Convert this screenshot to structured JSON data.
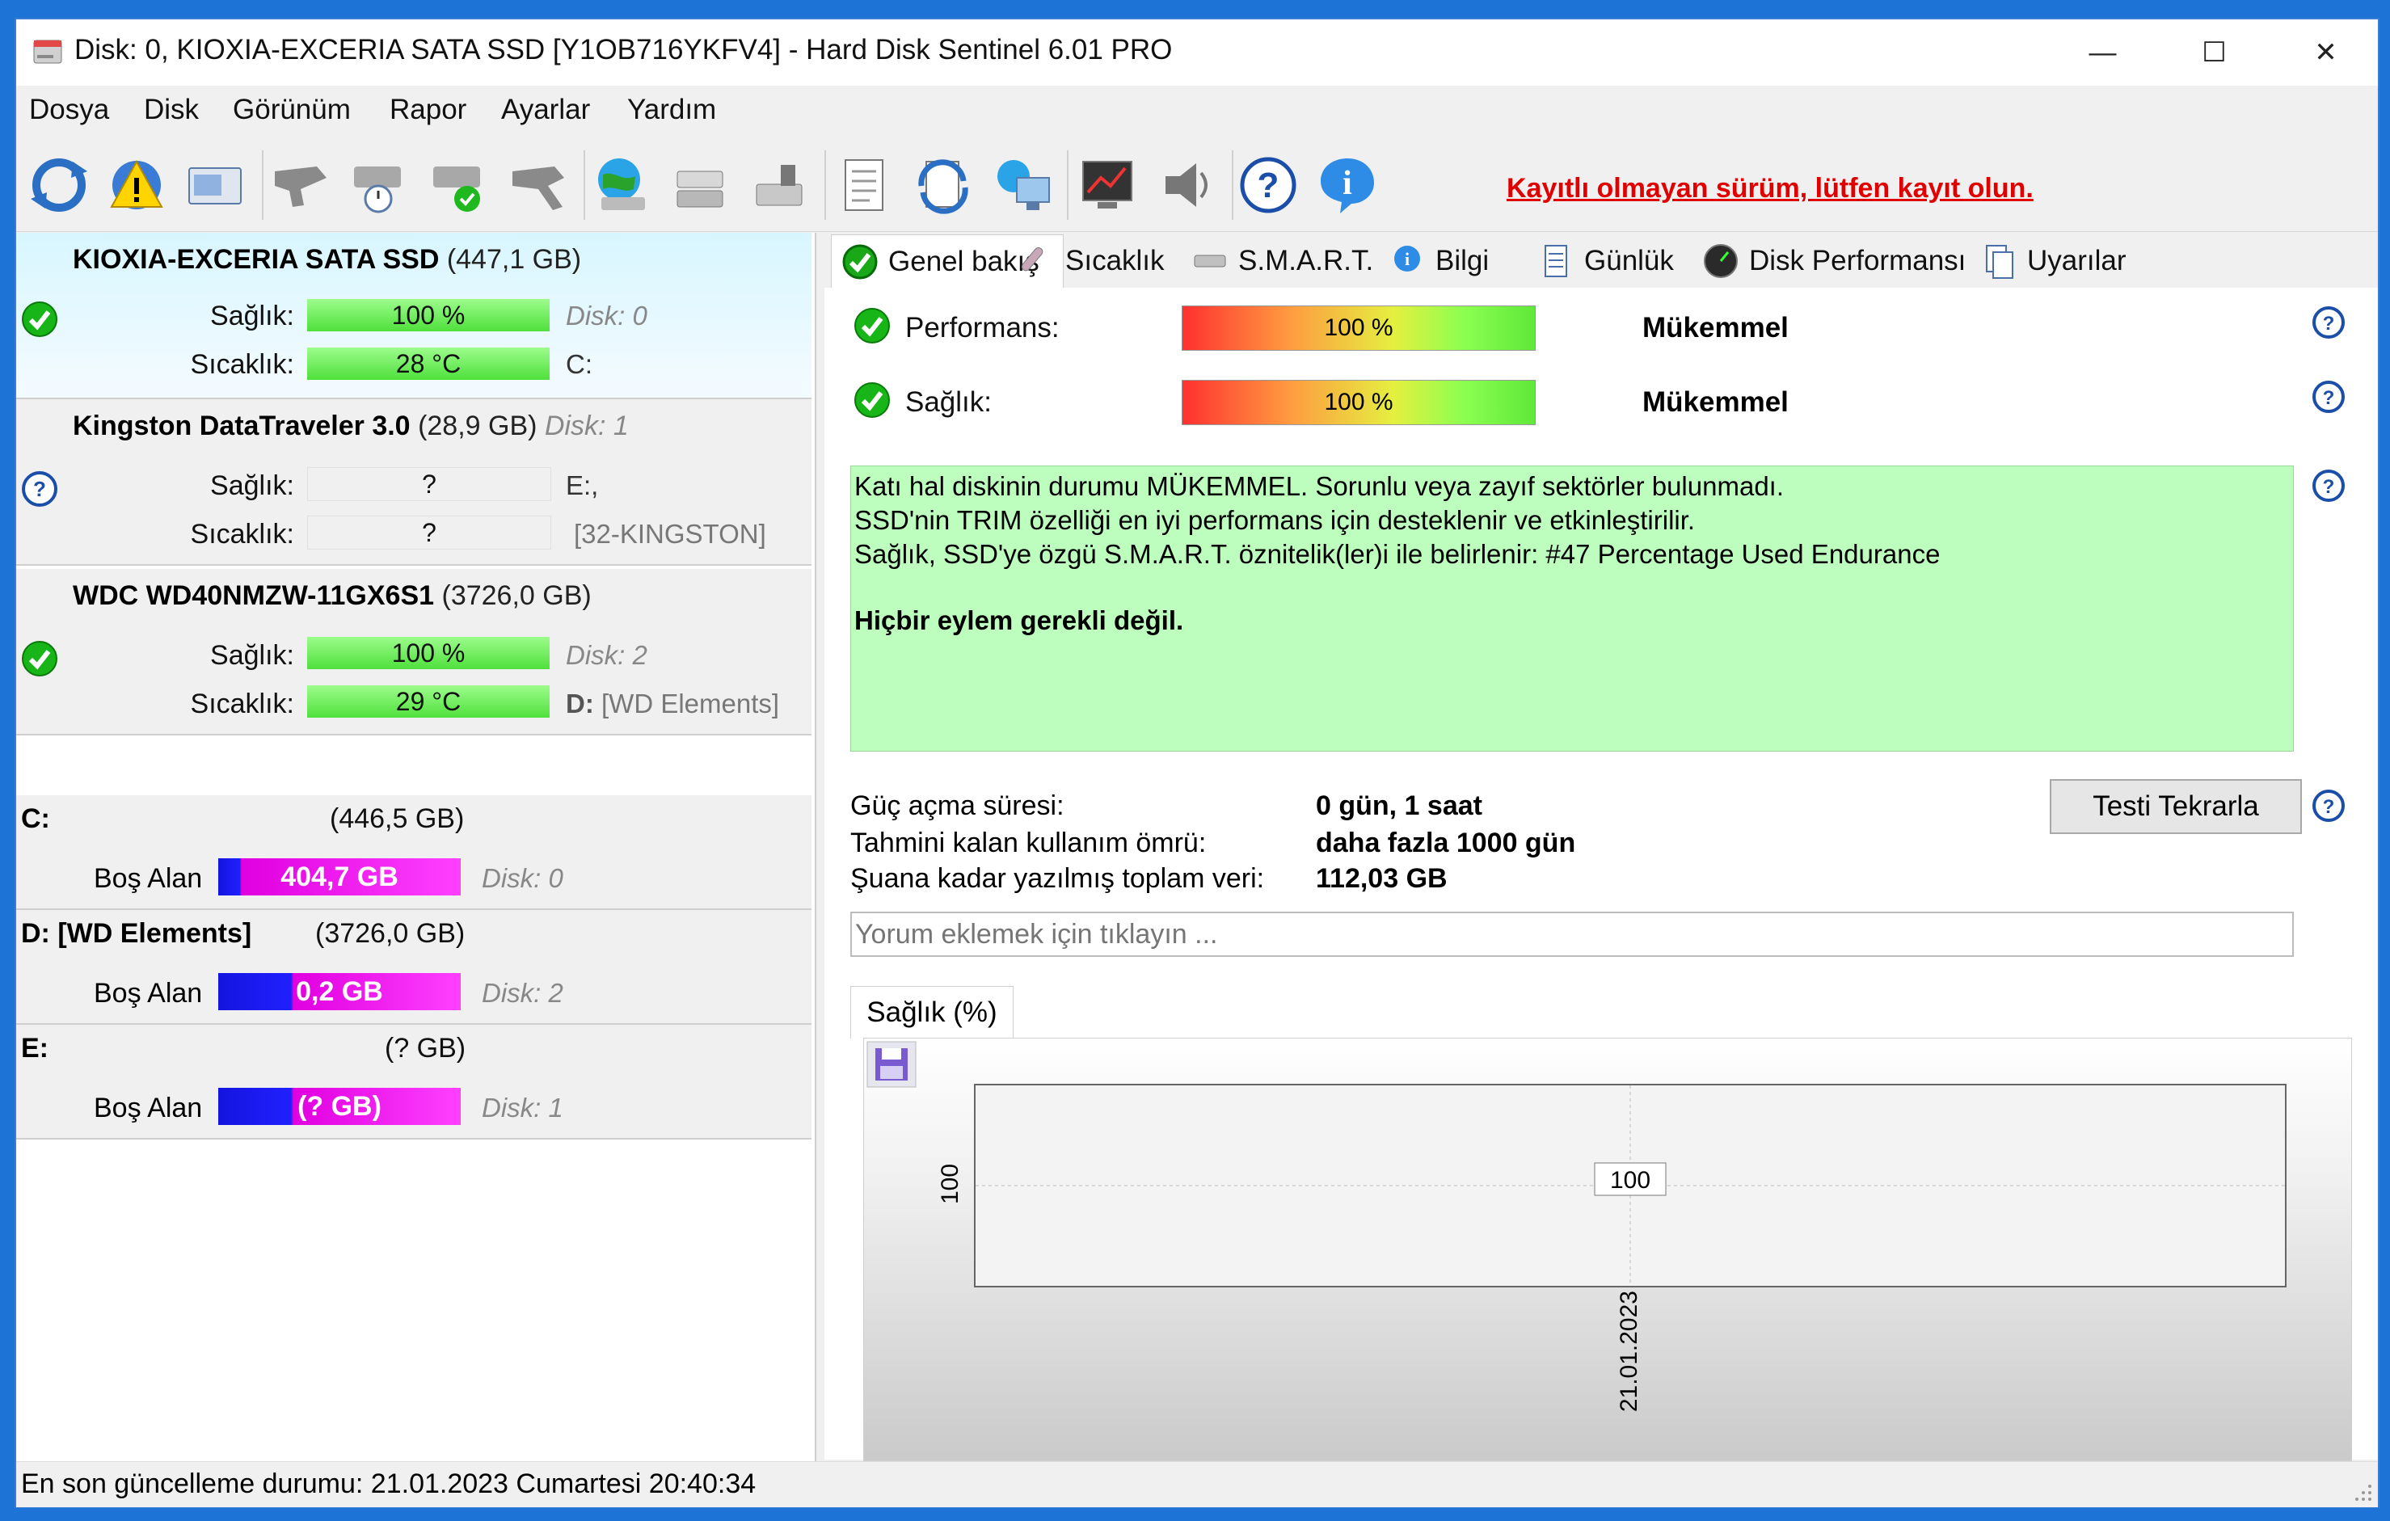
{
  "window": {
    "title": "Disk: 0, KIOXIA-EXCERIA SATA SSD [Y1OB716YKFV4]  -  Hard Disk Sentinel 6.01 PRO",
    "minimize": "—",
    "maximize": "☐",
    "close": "✕"
  },
  "menu": [
    {
      "label": "Dosya"
    },
    {
      "label": "Disk"
    },
    {
      "label": "Görünüm"
    },
    {
      "label": "Rapor"
    },
    {
      "label": "Ayarlar"
    },
    {
      "label": "Yardım"
    }
  ],
  "toolbar": {
    "register_text": "Kayıtlı olmayan sürüm, lütfen kayıt olun."
  },
  "disks": [
    {
      "name": "KIOXIA-EXCERIA SATA SSD",
      "size": "(447,1 GB)",
      "name_suffix": "",
      "health_label": "Sağlık:",
      "health_value": "100 %",
      "health_note": "Disk: 0",
      "temp_label": "Sıcaklık:",
      "temp_value": "28 °C",
      "temp_note": "C:",
      "status_icon": "check-icon"
    },
    {
      "name": "Kingston DataTraveler 3.0",
      "size": "(28,9 GB)",
      "name_suffix": "Disk: 1",
      "health_label": "Sağlık:",
      "health_value": "?",
      "health_note": "E:,",
      "temp_label": "Sıcaklık:",
      "temp_value": "?",
      "temp_note": "[32-KINGSTON]",
      "status_icon": "question-icon"
    },
    {
      "name": "WDC WD40NMZW-11GX6S1",
      "size": "(3726,0 GB)",
      "name_suffix": "",
      "health_label": "Sağlık:",
      "health_value": "100 %",
      "health_note": "Disk: 2",
      "temp_label": "Sıcaklık:",
      "temp_value": "29 °C",
      "temp_note_drive": "D:",
      "temp_note": "[WD Elements]",
      "status_icon": "check-icon"
    }
  ],
  "partitions": [
    {
      "title": "C:",
      "size": "(446,5 GB)",
      "free_label": "Boş Alan",
      "free_value": "404,7 GB",
      "disk": "Disk: 0",
      "used_fraction": 0.09
    },
    {
      "title": "D: [WD Elements]",
      "size": "(3726,0 GB)",
      "free_label": "Boş Alan",
      "free_value": "0,2 GB",
      "disk": "Disk: 2",
      "used_fraction": 0.33
    },
    {
      "title": "E:",
      "size": "(? GB)",
      "free_label": "Boş Alan",
      "free_value": "(? GB)",
      "disk": "Disk: 1",
      "used_fraction": 0.33
    }
  ],
  "tabs": [
    {
      "label": "Genel bakış",
      "icon": "check-icon"
    },
    {
      "label": "Sıcaklık",
      "icon": "thermometer-icon"
    },
    {
      "label": "S.M.A.R.T.",
      "icon": "drive-icon"
    },
    {
      "label": "Bilgi",
      "icon": "info-icon"
    },
    {
      "label": "Günlük",
      "icon": "log-icon"
    },
    {
      "label": "Disk Performansı",
      "icon": "gauge-icon"
    },
    {
      "label": "Uyarılar",
      "icon": "alerts-icon"
    }
  ],
  "overview": {
    "performance_label": "Performans:",
    "performance_value": "100 %",
    "performance_status": "Mükemmel",
    "health_label": "Sağlık:",
    "health_value": "100 %",
    "health_status": "Mükemmel",
    "status_lines": [
      "Katı hal diskinin durumu MÜKEMMEL. Sorunlu veya zayıf sektörler bulunmadı.",
      "SSD'nin TRIM özelliği en iyi performans için desteklenir ve etkinleştirilir.",
      "Sağlık, SSD'ye özgü S.M.A.R.T. öznitelik(ler)i ile belirlenir:  #47 Percentage Used Endurance"
    ],
    "status_action": "Hiçbir eylem gerekli değil.",
    "power_on_label": "Güç açma süresi:",
    "power_on_value": "0 gün, 1 saat",
    "lifetime_label": "Tahmini kalan kullanım ömrü:",
    "lifetime_value": "daha fazla 1000 gün",
    "written_label": "Şuana kadar yazılmış toplam veri:",
    "written_value": "112,03 GB",
    "retest_button": "Testi Tekrarla",
    "comment_placeholder": "Yorum eklemek için tıklayın ..."
  },
  "chart_tab": "Sağlık (%)",
  "chart_data": {
    "type": "line",
    "x": [
      "21.01.2023"
    ],
    "values": [
      100
    ],
    "xlabel": "",
    "ylabel": "",
    "y_tick_labels": [
      "100"
    ],
    "data_labels": [
      "100"
    ]
  },
  "statusbar": {
    "text": "En son güncelleme durumu: 21.01.2023 Cumartesi 20:40:34"
  },
  "colors": {
    "accent_red": "#e00000",
    "status_green_bg": "#bdfdbd"
  }
}
